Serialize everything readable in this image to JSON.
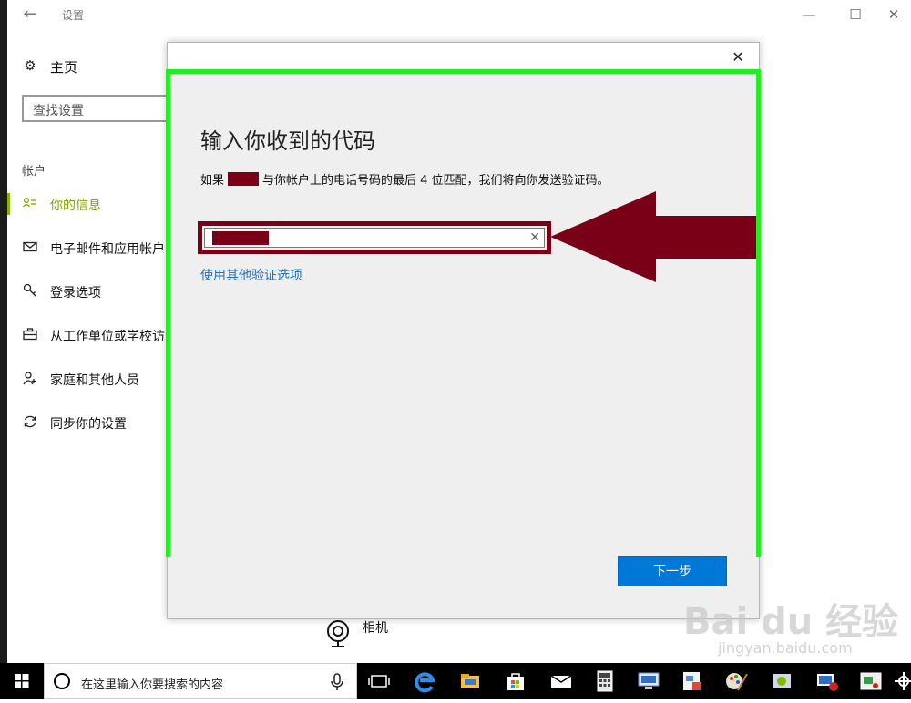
{
  "window": {
    "title": "设置",
    "back_glyph": "←",
    "minimize_glyph": "—",
    "maximize_glyph": "☐",
    "close_glyph": "✕"
  },
  "sidebar": {
    "home_label": "主页",
    "search_placeholder": "查找设置",
    "section_heading": "帐户",
    "items": [
      {
        "label": "你的信息",
        "icon": "person-card-icon",
        "active": true
      },
      {
        "label": "电子邮件和应用帐户",
        "icon": "mail-icon"
      },
      {
        "label": "登录选项",
        "icon": "key-icon"
      },
      {
        "label": "从工作单位或学校访问",
        "icon": "briefcase-icon"
      },
      {
        "label": "家庭和其他人员",
        "icon": "add-person-icon"
      },
      {
        "label": "同步你的设置",
        "icon": "sync-icon"
      }
    ],
    "accent_color": "#7ea300"
  },
  "background": {
    "camera_label": "相机"
  },
  "dialog": {
    "close_glyph": "✕",
    "heading": "输入你收到的代码",
    "desc_prefix": "如果",
    "desc_suffix": "与你帐户上的电话号码的最后 4 位匹配，我们将向你发送验证码。",
    "input_value": "",
    "clear_glyph": "✕",
    "alt_link": "使用其他验证选项",
    "next_button": "下一步",
    "button_color": "#0078d7",
    "annotation_frame_color": "#22ee22",
    "annotation_arrow_color": "#7a0018"
  },
  "taskbar": {
    "search_placeholder": "在这里输入你要搜索的内容",
    "icons": [
      "task-view-icon",
      "edge-icon",
      "file-explorer-icon",
      "store-icon",
      "mail-icon",
      "calculator-icon",
      "remote-desktop-icon",
      "app-icon",
      "paint-icon",
      "network-icon",
      "app-icon",
      "action-center-icon"
    ]
  },
  "watermark": {
    "logo": "Bai du 经验",
    "url": "jingyan.baidu.com"
  }
}
